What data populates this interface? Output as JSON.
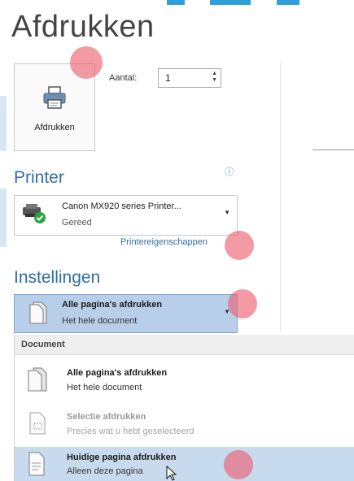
{
  "page": {
    "title": "Afdrukken"
  },
  "print": {
    "button_label": "Afdrukken",
    "copies_label": "Aantal:",
    "copies_value": "1"
  },
  "printer": {
    "section_title": "Printer",
    "name": "Canon MX920 series Printer...",
    "status": "Gereed",
    "properties_link": "Printereigenschappen"
  },
  "settings": {
    "section_title": "Instellingen",
    "selected": {
      "title": "Alle pagina's afdrukken",
      "subtitle": "Het hele document"
    }
  },
  "dropdown": {
    "group_header": "Document",
    "items": [
      {
        "title": "Alle pagina's afdrukken",
        "subtitle": "Het hele document",
        "state": "normal"
      },
      {
        "title": "Selectie afdrukken",
        "subtitle": "Precies wat u hebt geselecteerd",
        "state": "disabled"
      },
      {
        "title": "Huidige pagina afdrukken",
        "subtitle": "Alleen deze pagina",
        "state": "hover"
      }
    ]
  },
  "colors": {
    "accent": "#2f6fa0",
    "selection": "#b8cfe9",
    "hover": "#c8dbee",
    "click_marker": "#ec5c6c",
    "status_ok": "#2ea043"
  },
  "icons": [
    "printer-icon",
    "printer-status-icon",
    "info-icon",
    "document-icon",
    "selection-document-icon",
    "mouse-cursor-icon",
    "chevron-down-icon",
    "spin-arrows-icon"
  ]
}
